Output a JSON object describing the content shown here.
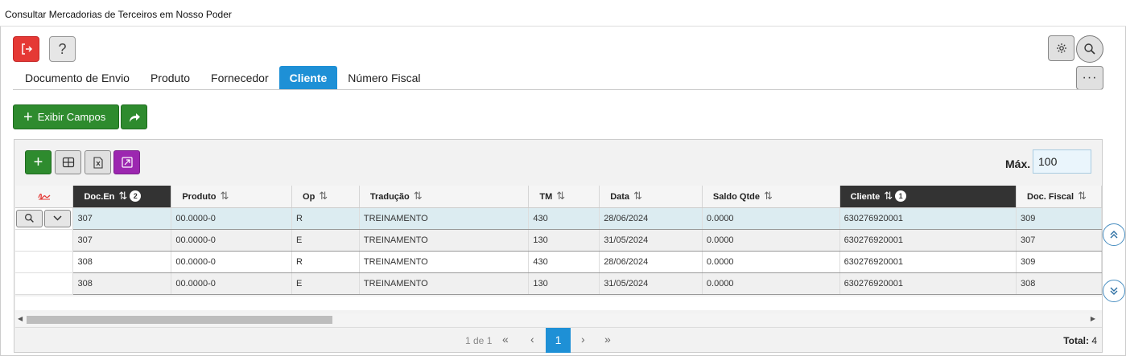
{
  "window": {
    "title": "Consultar Mercadorias de Terceiros em Nosso Poder"
  },
  "icons": {
    "exit": "exit-icon",
    "help": "?",
    "settings": "gear-icon",
    "search": "search-icon",
    "more": "···"
  },
  "tabs": [
    {
      "label": "Documento de Envio",
      "active": false
    },
    {
      "label": "Produto",
      "active": false
    },
    {
      "label": "Fornecedor",
      "active": false
    },
    {
      "label": "Cliente",
      "active": true
    },
    {
      "label": "Número Fiscal",
      "active": false
    }
  ],
  "toolbar": {
    "exibir_label": "Exibir Campos",
    "exibir_plus": "+"
  },
  "grid": {
    "add_plus": "+",
    "max_label": "Máx.",
    "max_value": "100",
    "columns": [
      {
        "label": "Doc.En",
        "sorted": true,
        "badge": "2"
      },
      {
        "label": "Produto",
        "sorted": false,
        "badge": ""
      },
      {
        "label": "Op",
        "sorted": false,
        "badge": ""
      },
      {
        "label": "Tradução",
        "sorted": false,
        "badge": ""
      },
      {
        "label": "TM",
        "sorted": false,
        "badge": ""
      },
      {
        "label": "Data",
        "sorted": false,
        "badge": ""
      },
      {
        "label": "Saldo Qtde",
        "sorted": false,
        "badge": ""
      },
      {
        "label": "Cliente",
        "sorted": true,
        "badge": "1"
      },
      {
        "label": "Doc. Fiscal",
        "sorted": false,
        "badge": ""
      }
    ],
    "rows": [
      [
        "307",
        "00.0000-0",
        "R",
        "TREINAMENTO",
        "430",
        "28/06/2024",
        "0.0000",
        "630276920001",
        "309"
      ],
      [
        "307",
        "00.0000-0",
        "E",
        "TREINAMENTO",
        "130",
        "31/05/2024",
        "0.0000",
        "630276920001",
        "307"
      ],
      [
        "308",
        "00.0000-0",
        "R",
        "TREINAMENTO",
        "430",
        "28/06/2024",
        "0.0000",
        "630276920001",
        "309"
      ],
      [
        "308",
        "00.0000-0",
        "E",
        "TREINAMENTO",
        "130",
        "31/05/2024",
        "0.0000",
        "630276920001",
        "308"
      ]
    ]
  },
  "pager": {
    "info": "1 de 1",
    "current": "1",
    "first": "«",
    "prev": "‹",
    "next": "›",
    "last": "»",
    "total_label": "Total:",
    "total_value": "4"
  },
  "colors": {
    "accent": "#1e90d6",
    "green": "#2e8b2e",
    "danger": "#e53935",
    "purple": "#9c27b0",
    "header_dark": "#333333"
  }
}
